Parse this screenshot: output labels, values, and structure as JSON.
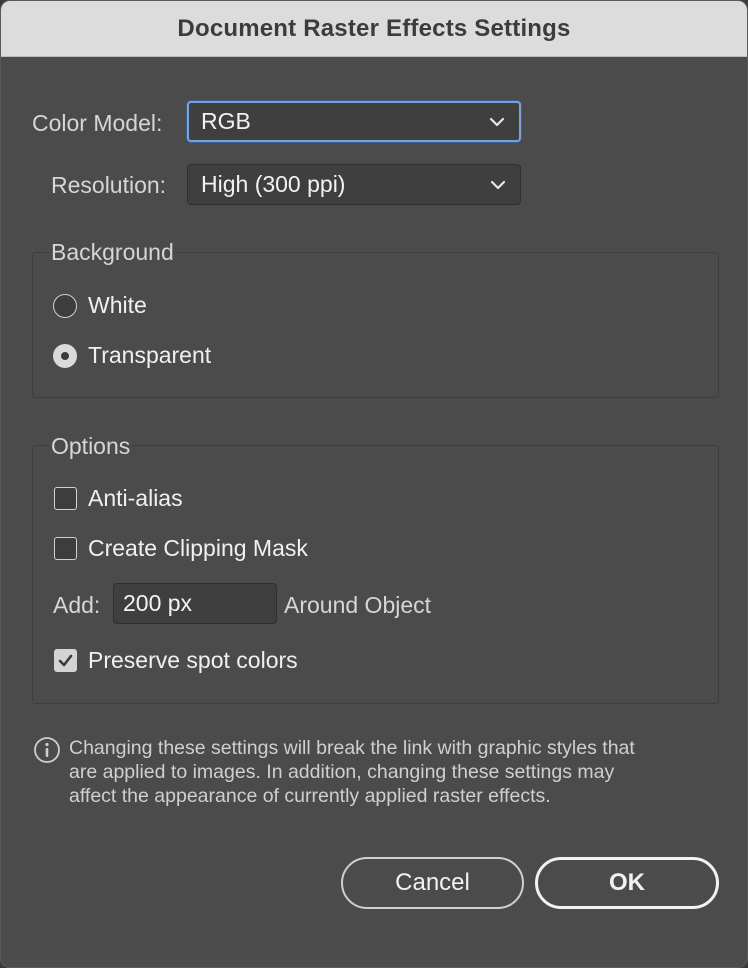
{
  "window": {
    "title": "Document Raster Effects Settings"
  },
  "color_model": {
    "label": "Color Model:",
    "value": "RGB"
  },
  "resolution": {
    "label": "Resolution:",
    "value": "High (300 ppi)"
  },
  "background": {
    "title": "Background",
    "options": [
      {
        "label": "White",
        "selected": false
      },
      {
        "label": "Transparent",
        "selected": true
      }
    ]
  },
  "options": {
    "title": "Options",
    "anti_alias": {
      "label": "Anti-alias",
      "checked": false
    },
    "clipping_mask": {
      "label": "Create Clipping Mask",
      "checked": false
    },
    "add": {
      "label": "Add:",
      "value": "200 px",
      "suffix": "Around Object"
    },
    "preserve_spot": {
      "label": "Preserve spot colors",
      "checked": true
    }
  },
  "info": {
    "icon": "info-icon",
    "lines": [
      "Changing these settings will break the link with graphic styles that",
      "are applied to images. In addition, changing these settings may",
      "affect the appearance of currently applied raster effects."
    ]
  },
  "buttons": {
    "cancel": "Cancel",
    "ok": "OK"
  },
  "colors": {
    "dialog_bg": "#4b4b4b",
    "titlebar_bg": "#dcdcdc",
    "focus_ring": "#7aa2d8"
  }
}
